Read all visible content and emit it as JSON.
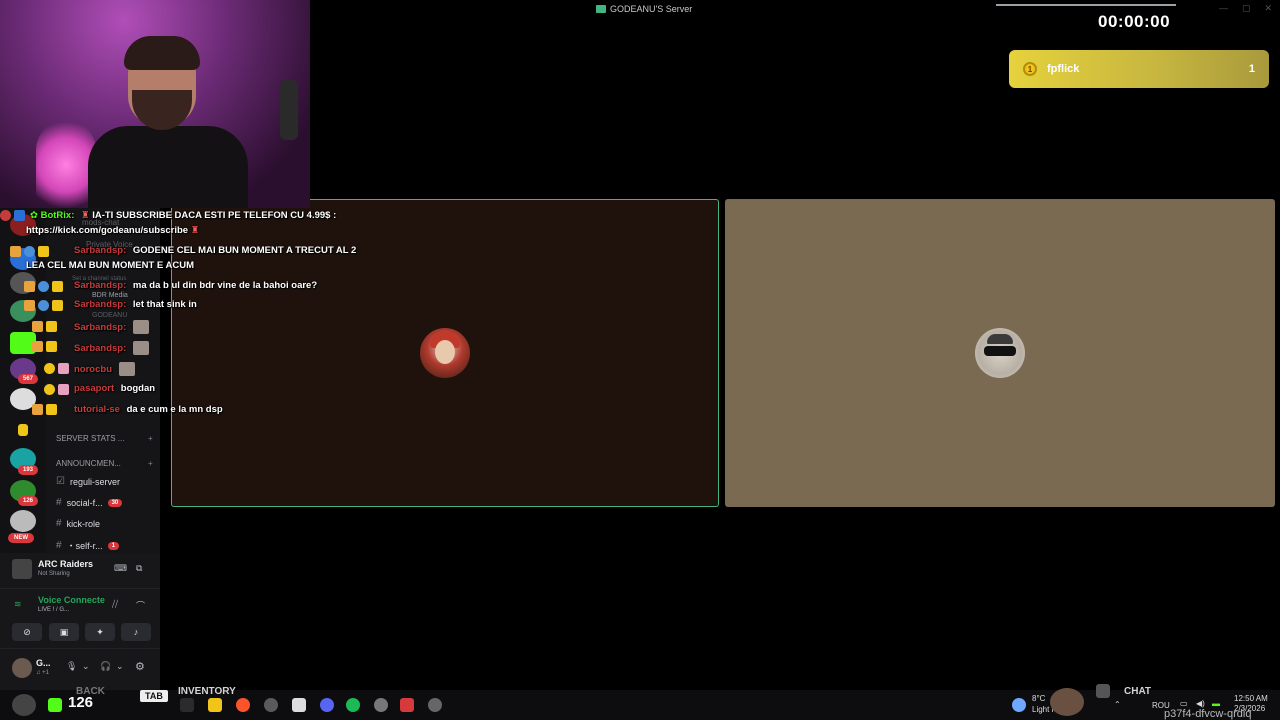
{
  "window": {
    "title": "GODEANU'S Server",
    "controls": [
      "—",
      "▢",
      "✕"
    ]
  },
  "timer": "00:00:00",
  "leaderboard": {
    "rank_icon": "1",
    "name": "fpflick",
    "value": "1"
  },
  "chat": [
    {
      "user": "BotRix:",
      "text": "IA-TI SUBSCRIBE DACA ESTI PE TELEFON CU 4.99$ :",
      "bot": true
    },
    {
      "user": "",
      "text": "https://kick.com/godeanu/subscribe",
      "bot": false
    },
    {
      "user": "Sarbandsp:",
      "text": "GODENE CEL MAI BUN MOMENT A TRECUT AL 2",
      "bot": false
    },
    {
      "user": "",
      "text": "LEA CEL MAI BUN MOMENT E ACUM",
      "bot": false
    },
    {
      "user": "Sarbandsp:",
      "text": "ma da b ul din bdr vine de la bahoi oare?",
      "bot": false
    },
    {
      "user": "Sarbandsp:",
      "text": "let that sink in",
      "bot": false
    },
    {
      "user": "Sarbandsp:",
      "text": "",
      "bot": false
    },
    {
      "user": "Sarbandsp:",
      "text": "",
      "bot": false
    },
    {
      "user": "norocbu",
      "text": "",
      "bot": false
    },
    {
      "user": "pasaport",
      "text": "bogdan",
      "bot": false
    },
    {
      "user": "tutorial-se",
      "text": "da e cum e la mn dsp",
      "bot": false
    }
  ],
  "discord": {
    "faded": {
      "mods_chat": "mods-chat",
      "private_voice": "Private Voice",
      "channel_status": "Set a channel status",
      "bdr_media": "BDR Media",
      "godeanu": "GODEANU"
    },
    "server_badges": [
      "567",
      "193",
      "126"
    ],
    "new_badge": "NEW",
    "categories": [
      "SERVER STATS ...",
      "ANNOUNCMEN..."
    ],
    "channels": [
      {
        "name": "reguli-server",
        "badge": ""
      },
      {
        "name": "social-f...",
        "badge": "30"
      },
      {
        "name": "kick-role",
        "badge": ""
      },
      {
        "name": "・self-r...",
        "badge": "1"
      }
    ],
    "activity": {
      "game": "ARC Raiders",
      "sub": "Not Sharing"
    },
    "voice": {
      "status": "Voice Connecte",
      "sub": "LIVE ! / G..."
    },
    "user": {
      "name": "G...",
      "sub": "♫ +1"
    }
  },
  "taskbar": {
    "number": "126",
    "back": "BACK",
    "tab": "TAB",
    "inventory": "INVENTORY",
    "chat": "CHAT",
    "weather": {
      "temp": "8°C",
      "desc": "Light rain"
    },
    "lang": "ROU",
    "time": "12:50 AM",
    "date": "2/3/2026",
    "code": "p37f4-dfvcw-qrdiq"
  },
  "colors": {
    "accent_green": "#43b581",
    "kick_green": "#53fc18",
    "chat_user_red": "#c63b3b",
    "leader_yellow": "#e6d23c"
  }
}
